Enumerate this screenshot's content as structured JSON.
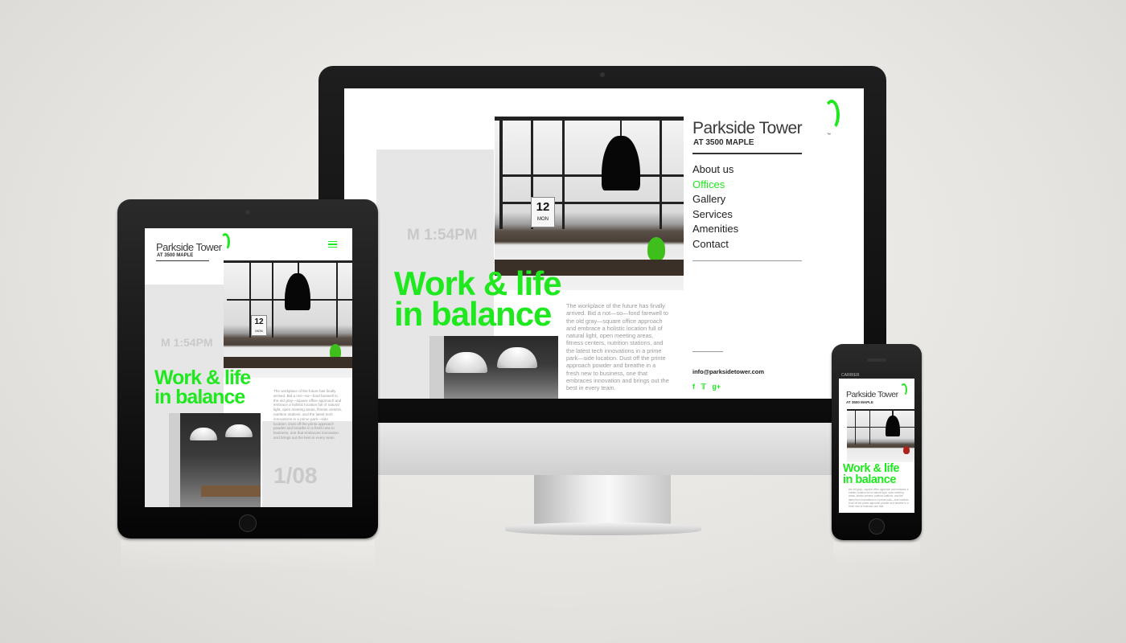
{
  "brand": {
    "name": "Parkside Tower",
    "tm": "™",
    "tagline": "AT 3500 MAPLE",
    "accent": "#1fe81f"
  },
  "nav": {
    "items": [
      {
        "label": "About us"
      },
      {
        "label": "Offices"
      },
      {
        "label": "Gallery"
      },
      {
        "label": "Services"
      },
      {
        "label": "Amenities"
      },
      {
        "label": "Contact"
      }
    ],
    "active_index": 1,
    "menu_icon": "hamburger-icon"
  },
  "hero": {
    "clock": "M 1:54PM",
    "headline_line1": "Work & life",
    "headline_line2": "in balance",
    "body": "The workplace of the future has finally arrived. Bid a not—so—fond farewell to the old gray—square office approach and embrace a holistic location full of natural light, open meeting areas, fitness centers, nutrition stations, and the latest tech innovations in a prime park—side location. Dust off the printe approach powder and breathe in a fresh new to business, one that embraces innovation and brings out the best in every team.",
    "calendar_day": "12",
    "calendar_weekday": "MON"
  },
  "tablet": {
    "slide_counter": "1/08",
    "body": "The workplace of the future has finally arrived. Bid a not—so—fond farewell to the old gray—square office approach and embrace a holistic location full of natural light, open meeting areas, fitness centers, nutrition stations, and the latest tech innovations in a prime park—side location. Dust off the printe approach powder and breathe in a fresh new to business, one that embraces innovation and brings out the best in every team."
  },
  "phone": {
    "carrier": "CARRIER",
    "body": "the old gray—square office approach and embrace a holistic location full of natural light, open meeting areas, fitness centers, nutrition stations, and the latest tech innovations in a prime park—side location. Dust off the printe approach powder and breathe in a fresh new to business one that"
  },
  "contact": {
    "email": "info@parksidetower.com"
  },
  "social": [
    {
      "label": "f",
      "icon": "facebook-icon"
    },
    {
      "label": "🐦",
      "icon": "twitter-icon"
    },
    {
      "label": "g+",
      "icon": "google-plus-icon"
    }
  ]
}
